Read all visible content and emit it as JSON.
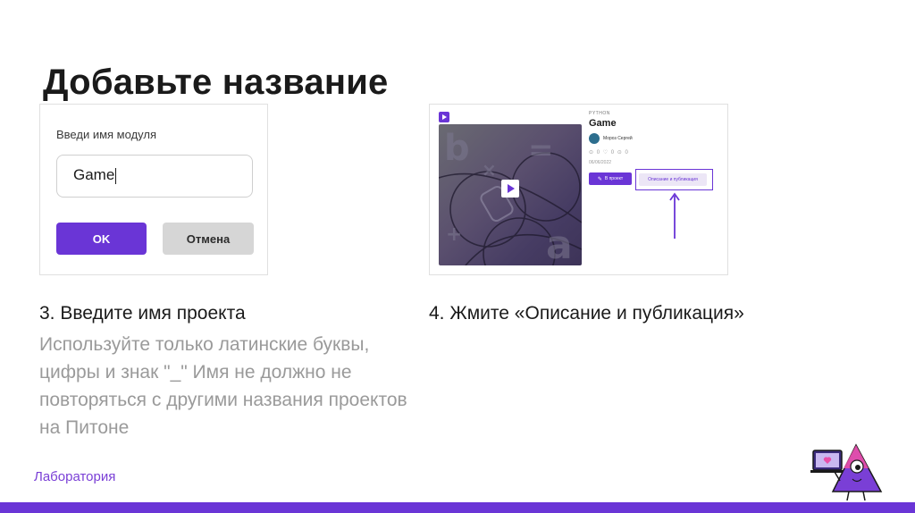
{
  "slide": {
    "title": "Добавьте название"
  },
  "dialog": {
    "label": "Введи имя модуля",
    "input_value": "Game",
    "ok_label": "OK",
    "cancel_label": "Отмена"
  },
  "project_card": {
    "language": "PYTHON",
    "name": "Game",
    "author": "Мороз Сергей",
    "stats": "⊙ 0  ♡ 0  ⊙ 0",
    "date": "06/06/2022",
    "to_project_label": "В проект",
    "describe_label": "Описание и публикация",
    "icons": [
      "play-icon",
      "pencil-icon",
      "arrow-up-icon",
      "logo-icon"
    ]
  },
  "captions": {
    "step3": "3. Введите имя проекта",
    "hint": "Используйте только латинские буквы, цифры и знак \"_\" Имя не должно не повторяться с другими названия проектов на Питоне",
    "step4": "4. Жмите «Описание и публикация»"
  },
  "footer": {
    "label": "Лаборатория"
  },
  "colors": {
    "accent": "#6a35d6",
    "cancel_bg": "#d6d6d6",
    "hint_text": "#9a9a9a",
    "mascot_pink": "#e94fa8"
  }
}
